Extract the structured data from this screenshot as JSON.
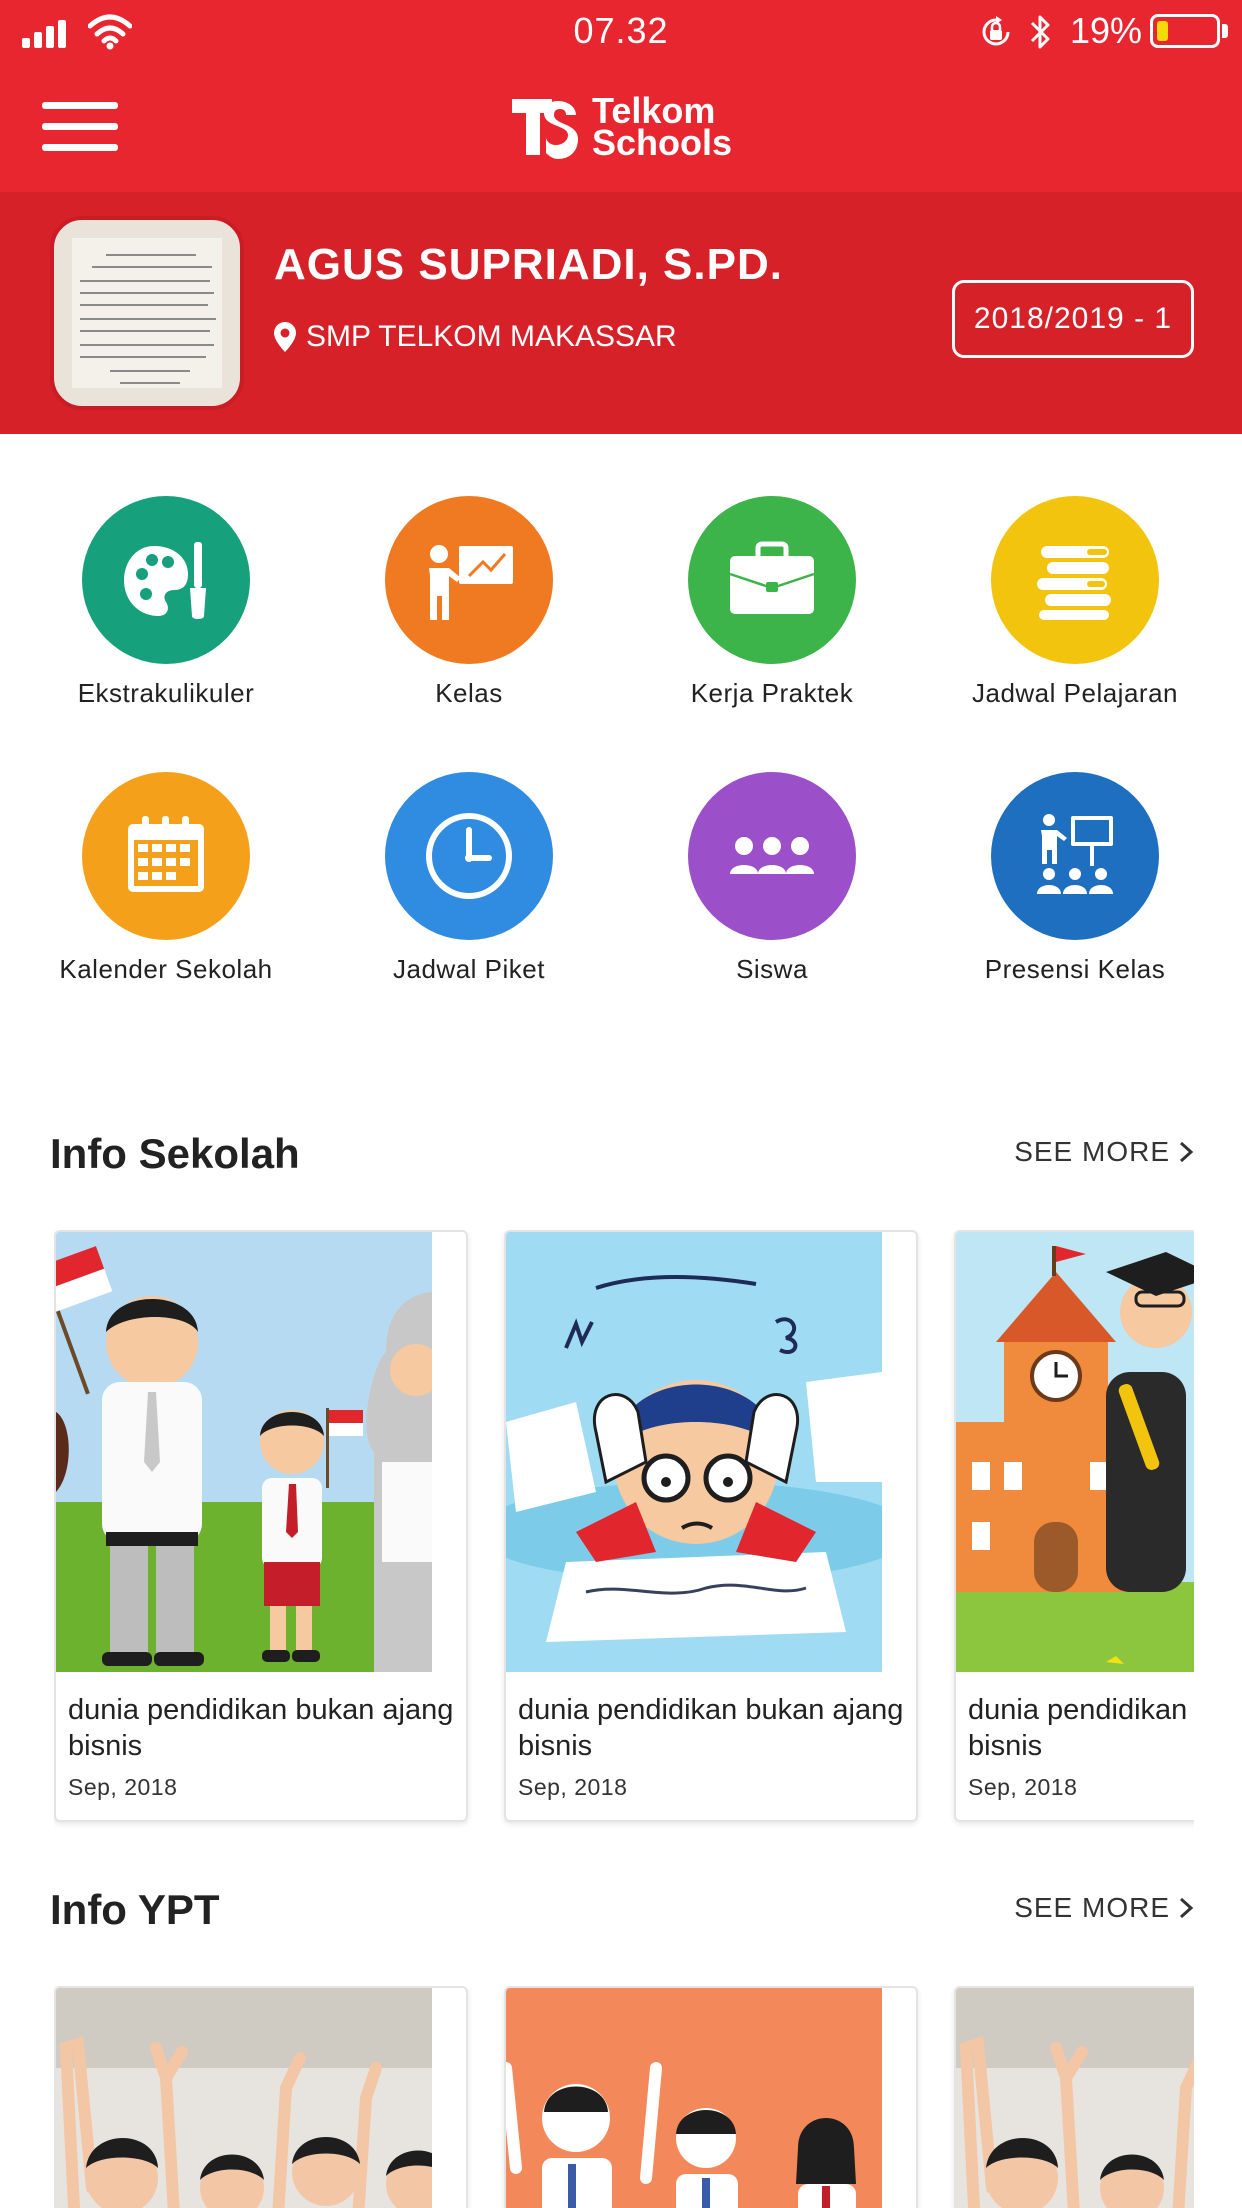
{
  "status_bar": {
    "time": "07.32",
    "battery_percent": "19%",
    "battery_level": 0.19
  },
  "header": {
    "logo_line1": "Telkom",
    "logo_line2": "Schools"
  },
  "profile": {
    "name": "AGUS SUPRIADI, S.PD.",
    "school": "SMP TELKOM MAKASSAR",
    "period": "2018/2019 - 1"
  },
  "menu": [
    {
      "label": "Ekstrakulikuler",
      "icon": "palette-icon",
      "color": "#16a07c"
    },
    {
      "label": "Kelas",
      "icon": "teacher-board-icon",
      "color": "#ef7a22"
    },
    {
      "label": "Kerja Praktek",
      "icon": "briefcase-icon",
      "color": "#3cb44a"
    },
    {
      "label": "Jadwal Pelajaran",
      "icon": "books-icon",
      "color": "#f2c40d"
    },
    {
      "label": "Kalender Sekolah",
      "icon": "calendar-icon",
      "color": "#f5a01a"
    },
    {
      "label": "Jadwal Piket",
      "icon": "clock-icon",
      "color": "#2f8ce0"
    },
    {
      "label": "Siswa",
      "icon": "students-icon",
      "color": "#9b4fc8"
    },
    {
      "label": "Presensi Kelas",
      "icon": "presentation-icon",
      "color": "#1f6fc0"
    }
  ],
  "info_sekolah": {
    "title": "Info Sekolah",
    "see_more": "SEE MORE",
    "cards": [
      {
        "title": "dunia pendidikan bukan ajang bisnis",
        "date": "Sep, 2018"
      },
      {
        "title": "dunia pendidikan bukan ajang bisnis",
        "date": "Sep, 2018"
      },
      {
        "title": "dunia pendidikan bukan ajang bisnis",
        "date": "Sep, 2018"
      }
    ]
  },
  "info_ypt": {
    "title": "Info YPT",
    "see_more": "SEE MORE"
  },
  "colors": {
    "brand_red": "#e8262f",
    "profile_red": "#d62129"
  }
}
